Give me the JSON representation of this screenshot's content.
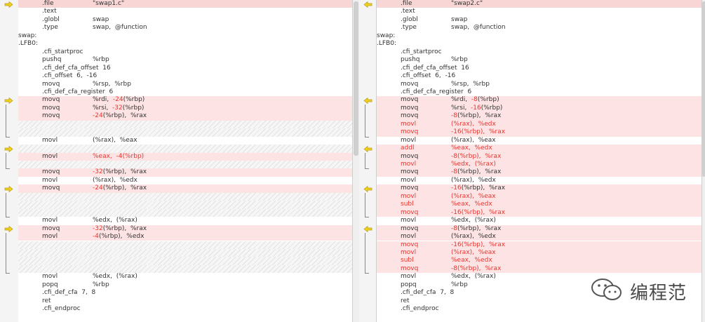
{
  "watermark": {
    "text": "编程范",
    "icon": "wechat-icon"
  },
  "colors": {
    "diff_bg": "#fde3e3",
    "changed_text": "#e8352f",
    "arrow": "#f2d21c"
  },
  "left": {
    "rows": [
      {
        "k": "l",
        "i": 1,
        "a": ".file",
        "b": "\"swap1.c\"",
        "first": true
      },
      {
        "k": "l",
        "i": 1,
        "a": ".text"
      },
      {
        "k": "l",
        "i": 1,
        "a": ".globl",
        "b": "swap"
      },
      {
        "k": "l",
        "i": 1,
        "a": ".type",
        "b": "swap,  @function"
      },
      {
        "k": "l",
        "i": 0,
        "a": "swap:"
      },
      {
        "k": "l",
        "i": 0,
        "a": ".LFB0:"
      },
      {
        "k": "l",
        "i": 1,
        "a": ".cfi_startproc"
      },
      {
        "k": "l",
        "i": 1,
        "a": "pushq",
        "b": "%rbp"
      },
      {
        "k": "l",
        "i": 1,
        "a": ".cfi_def_cfa_offset  16"
      },
      {
        "k": "l",
        "i": 1,
        "a": ".cfi_offset  6,  -16"
      },
      {
        "k": "l",
        "i": 1,
        "a": "movq",
        "b": "%rsp,  %rbp"
      },
      {
        "k": "l",
        "i": 1,
        "a": ".cfi_def_cfa_register  6"
      },
      {
        "k": "d",
        "i": 1,
        "a": "movq",
        "b1": "%rdi,  ",
        "b2": "-24",
        "b3": "(%rbp)"
      },
      {
        "k": "d",
        "i": 1,
        "a": "movq",
        "b1": "%rsi,  ",
        "b2": "-32",
        "b3": "(%rbp)"
      },
      {
        "k": "d",
        "i": 1,
        "a": "movq",
        "b1": "",
        "b2": "-24",
        "b3": "(%rbp),  %rax"
      },
      {
        "k": "f"
      },
      {
        "k": "f"
      },
      {
        "k": "l",
        "i": 1,
        "a": "movl",
        "b": "(%rax),  %eax"
      },
      {
        "k": "f"
      },
      {
        "k": "d",
        "i": 1,
        "a": "movl",
        "b1": "",
        "b2": "%eax,  -4(%rbp)",
        "b3": ""
      },
      {
        "k": "f"
      },
      {
        "k": "d",
        "i": 1,
        "a": "movq",
        "b1": "",
        "b2": "-32",
        "b3": "(%rbp),  %rax"
      },
      {
        "k": "l",
        "i": 1,
        "a": "movl",
        "b": "(%rax),  %edx"
      },
      {
        "k": "d",
        "i": 1,
        "a": "movq",
        "b1": "",
        "b2": "-24",
        "b3": "(%rbp),  %rax"
      },
      {
        "k": "f"
      },
      {
        "k": "f"
      },
      {
        "k": "f"
      },
      {
        "k": "l",
        "i": 1,
        "a": "movl",
        "b": "%edx,  (%rax)"
      },
      {
        "k": "d",
        "i": 1,
        "a": "movq",
        "b1": "",
        "b2": "-32",
        "b3": "(%rbp),  %rax"
      },
      {
        "k": "d",
        "i": 1,
        "a": "movl",
        "b1": "",
        "b2": "-4",
        "b3": "(%rbp),  %edx"
      },
      {
        "k": "f"
      },
      {
        "k": "f"
      },
      {
        "k": "f"
      },
      {
        "k": "f"
      },
      {
        "k": "l",
        "i": 1,
        "a": "movl",
        "b": "%edx,  (%rax)"
      },
      {
        "k": "l",
        "i": 1,
        "a": "popq",
        "b": "%rbp"
      },
      {
        "k": "l",
        "i": 1,
        "a": ".cfi_def_cfa  7,  8"
      },
      {
        "k": "l",
        "i": 1,
        "a": "ret"
      },
      {
        "k": "l",
        "i": 1,
        "a": ".cfi_endproc"
      }
    ]
  },
  "right": {
    "rows": [
      {
        "k": "l",
        "i": 1,
        "a": ".file",
        "b": "\"swap2.c\"",
        "first": true
      },
      {
        "k": "l",
        "i": 1,
        "a": ".text"
      },
      {
        "k": "l",
        "i": 1,
        "a": ".globl",
        "b": "swap"
      },
      {
        "k": "l",
        "i": 1,
        "a": ".type",
        "b": "swap,  @function"
      },
      {
        "k": "l",
        "i": 0,
        "a": "swap:"
      },
      {
        "k": "l",
        "i": 0,
        "a": ".LFB0:"
      },
      {
        "k": "l",
        "i": 1,
        "a": ".cfi_startproc"
      },
      {
        "k": "l",
        "i": 1,
        "a": "pushq",
        "b": "%rbp"
      },
      {
        "k": "l",
        "i": 1,
        "a": ".cfi_def_cfa_offset  16"
      },
      {
        "k": "l",
        "i": 1,
        "a": ".cfi_offset  6,  -16"
      },
      {
        "k": "l",
        "i": 1,
        "a": "movq",
        "b": "%rsp,  %rbp"
      },
      {
        "k": "l",
        "i": 1,
        "a": ".cfi_def_cfa_register  6"
      },
      {
        "k": "d",
        "i": 1,
        "a": "movq",
        "b1": "%rdi,  ",
        "b2": "-8",
        "b3": "(%rbp)"
      },
      {
        "k": "d",
        "i": 1,
        "a": "movq",
        "b1": "%rsi,  ",
        "b2": "-16",
        "b3": "(%rbp)"
      },
      {
        "k": "d",
        "i": 1,
        "a": "movq",
        "b1": "",
        "b2": "-8",
        "b3": "(%rbp),  %rax"
      },
      {
        "k": "d",
        "i": 1,
        "a": "movl",
        "ar": true,
        "b1": "",
        "b2": "(%rax),  %edx",
        "b3": ""
      },
      {
        "k": "d",
        "i": 1,
        "a": "movq",
        "ar": true,
        "b1": "",
        "b2": "-16(%rbp),  %rax",
        "b3": ""
      },
      {
        "k": "l",
        "i": 1,
        "a": "movl",
        "b": "(%rax),  %eax"
      },
      {
        "k": "d",
        "i": 1,
        "a": "addl",
        "ar": true,
        "b1": "",
        "b2": "%eax,  %edx",
        "b3": ""
      },
      {
        "k": "d",
        "i": 1,
        "a": "movq",
        "b1": "",
        "b2": "-8(%rbp),  %rax",
        "b3": ""
      },
      {
        "k": "d",
        "i": 1,
        "a": "movl",
        "ar": true,
        "b1": "",
        "b2": "%edx,  (%rax)",
        "b3": ""
      },
      {
        "k": "d",
        "i": 1,
        "a": "movq",
        "b1": "",
        "b2": "-8",
        "b3": "(%rbp),  %rax"
      },
      {
        "k": "l",
        "i": 1,
        "a": "movl",
        "b": "(%rax),  %edx"
      },
      {
        "k": "d",
        "i": 1,
        "a": "movq",
        "b1": "",
        "b2": "-16",
        "b3": "(%rbp),  %rax"
      },
      {
        "k": "d",
        "i": 1,
        "a": "movl",
        "ar": true,
        "b1": "",
        "b2": "(%rax),  %eax",
        "b3": ""
      },
      {
        "k": "d",
        "i": 1,
        "a": "subl",
        "ar": true,
        "b1": "",
        "b2": "%eax,  %edx",
        "b3": ""
      },
      {
        "k": "d",
        "i": 1,
        "a": "movq",
        "ar": true,
        "b1": "",
        "b2": "-16(%rbp),  %rax",
        "b3": ""
      },
      {
        "k": "l",
        "i": 1,
        "a": "movl",
        "b": "%edx,  (%rax)"
      },
      {
        "k": "d",
        "i": 1,
        "a": "movq",
        "b1": "",
        "b2": "-8",
        "b3": "(%rbp),  %rax"
      },
      {
        "k": "d",
        "i": 1,
        "a": "movl",
        "b1": "(%rax),  %edx",
        "b2": "",
        "b3": ""
      },
      {
        "k": "d",
        "i": 1,
        "a": "movq",
        "ar": true,
        "b1": "",
        "b2": "-16(%rbp),  %rax",
        "b3": ""
      },
      {
        "k": "d",
        "i": 1,
        "a": "movl",
        "ar": true,
        "b1": "",
        "b2": "(%rax),  %eax",
        "b3": ""
      },
      {
        "k": "d",
        "i": 1,
        "a": "subl",
        "ar": true,
        "b1": "",
        "b2": "%eax,  %edx",
        "b3": ""
      },
      {
        "k": "d",
        "i": 1,
        "a": "movq",
        "ar": true,
        "b1": "",
        "b2": "-8(%rbp),  %rax",
        "b3": ""
      },
      {
        "k": "l",
        "i": 1,
        "a": "movl",
        "b": "%edx,  (%rax)"
      },
      {
        "k": "l",
        "i": 1,
        "a": "popq",
        "b": "%rbp"
      },
      {
        "k": "l",
        "i": 1,
        "a": ".cfi_def_cfa  7,  8"
      },
      {
        "k": "l",
        "i": 1,
        "a": "ret"
      },
      {
        "k": "l",
        "i": 1,
        "a": ".cfi_endproc"
      }
    ]
  },
  "left_gutter": {
    "arrow_rows": [
      0,
      12,
      18,
      23,
      28
    ],
    "brackets": [
      [
        12,
        16
      ],
      [
        18,
        20
      ],
      [
        23,
        26
      ],
      [
        28,
        33
      ]
    ]
  },
  "mid_gutter": {
    "arrow_rows": [
      0,
      12,
      18,
      23,
      28
    ],
    "brackets": [
      [
        12,
        16
      ],
      [
        18,
        20
      ],
      [
        23,
        26
      ],
      [
        28,
        33
      ]
    ]
  }
}
